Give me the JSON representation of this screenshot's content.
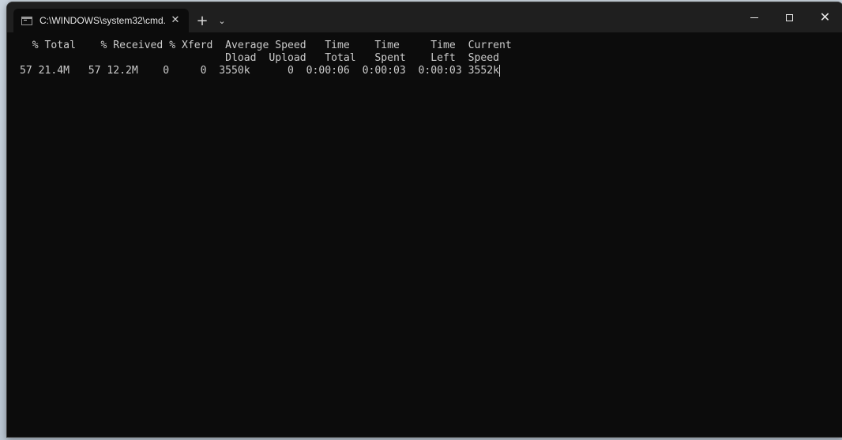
{
  "window": {
    "tab_title": "C:\\WINDOWS\\system32\\cmd.",
    "tab_close_glyph": "✕",
    "new_tab_glyph": "+",
    "dropdown_glyph": "⌄",
    "close_glyph": "✕"
  },
  "terminal": {
    "lines": [
      "  % Total    % Received % Xferd  Average Speed   Time    Time     Time  Current",
      "                                 Dload  Upload   Total   Spent    Left  Speed",
      "57 21.4M   57 12.2M    0     0  3550k      0  0:00:06  0:00:03  0:00:03 3552k"
    ]
  },
  "icons": {
    "tab": "terminal-icon",
    "minimize": "minimize-icon",
    "maximize": "maximize-icon",
    "close": "close-icon"
  }
}
